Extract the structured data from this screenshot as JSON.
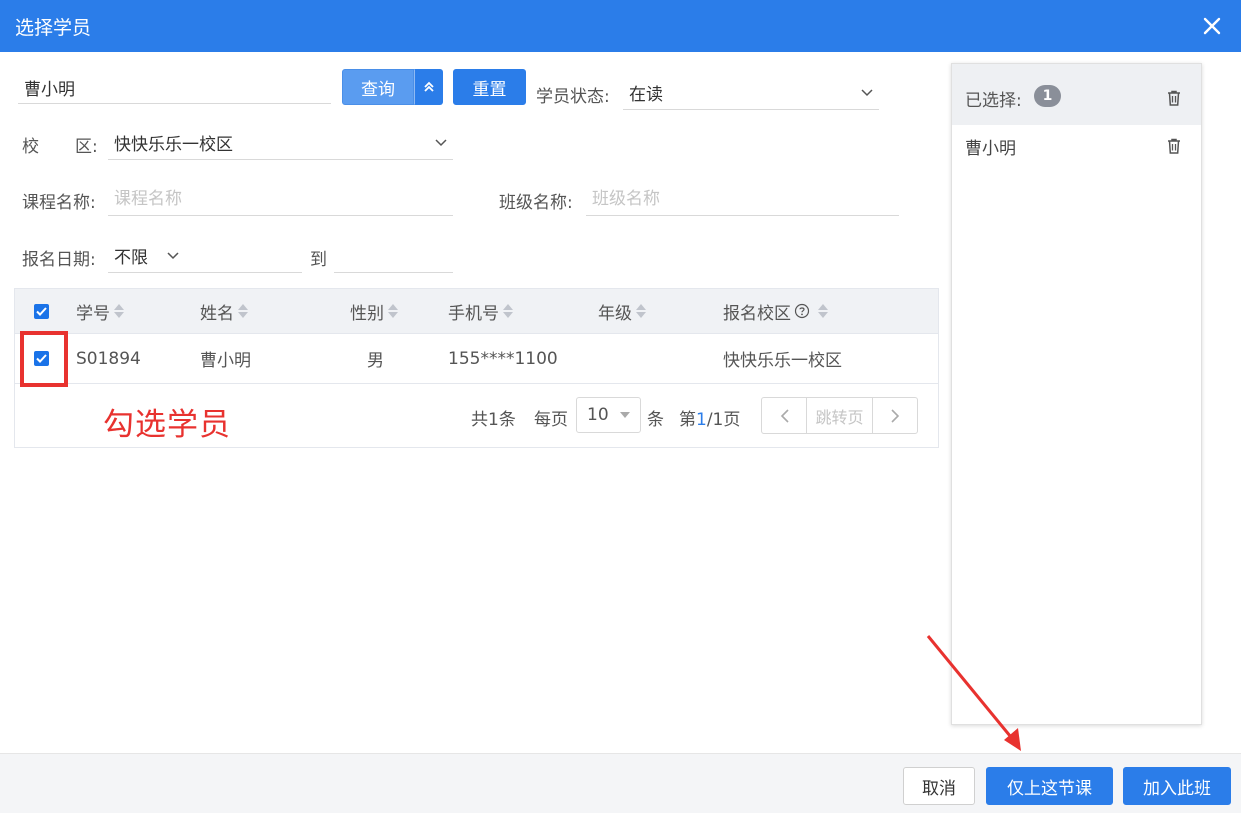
{
  "dialog": {
    "title": "选择学员"
  },
  "search": {
    "name_value": "曹小明",
    "query_label": "查询",
    "reset_label": "重置",
    "status_label": "学员状态:",
    "status_value": "在读",
    "campus_label_1": "校",
    "campus_label_2": "区:",
    "campus_value": "快快乐乐一校区",
    "course_label": "课程名称:",
    "course_placeholder": "课程名称",
    "class_label": "班级名称:",
    "class_placeholder": "班级名称",
    "date_label": "报名日期:",
    "date_range_value": "不限",
    "date_to": "到"
  },
  "table": {
    "headers": [
      "学号",
      "姓名",
      "性别",
      "手机号",
      "年级",
      "报名校区"
    ],
    "rows": [
      {
        "id": "S01894",
        "name": "曹小明",
        "gender": "男",
        "phone": "155****1100",
        "grade": "",
        "campus": "快快乐乐一校区"
      }
    ]
  },
  "pagination": {
    "total": "共1条",
    "per_page_label": "每页",
    "per_page_value": "10",
    "per_page_unit": "条",
    "page_prefix": "第",
    "page_current": "1",
    "page_suffix": "/1页",
    "jump_placeholder": "跳转页"
  },
  "selected_panel": {
    "header_label": "已选择:",
    "count": "1",
    "items": [
      "曹小明"
    ]
  },
  "footer": {
    "cancel_label": "取消",
    "this_lesson_label": "仅上这节课",
    "join_class_label": "加入此班"
  },
  "annotation": {
    "text": "勾选学员"
  },
  "colors": {
    "primary": "#2b7de9",
    "annotation": "#e8322f"
  }
}
